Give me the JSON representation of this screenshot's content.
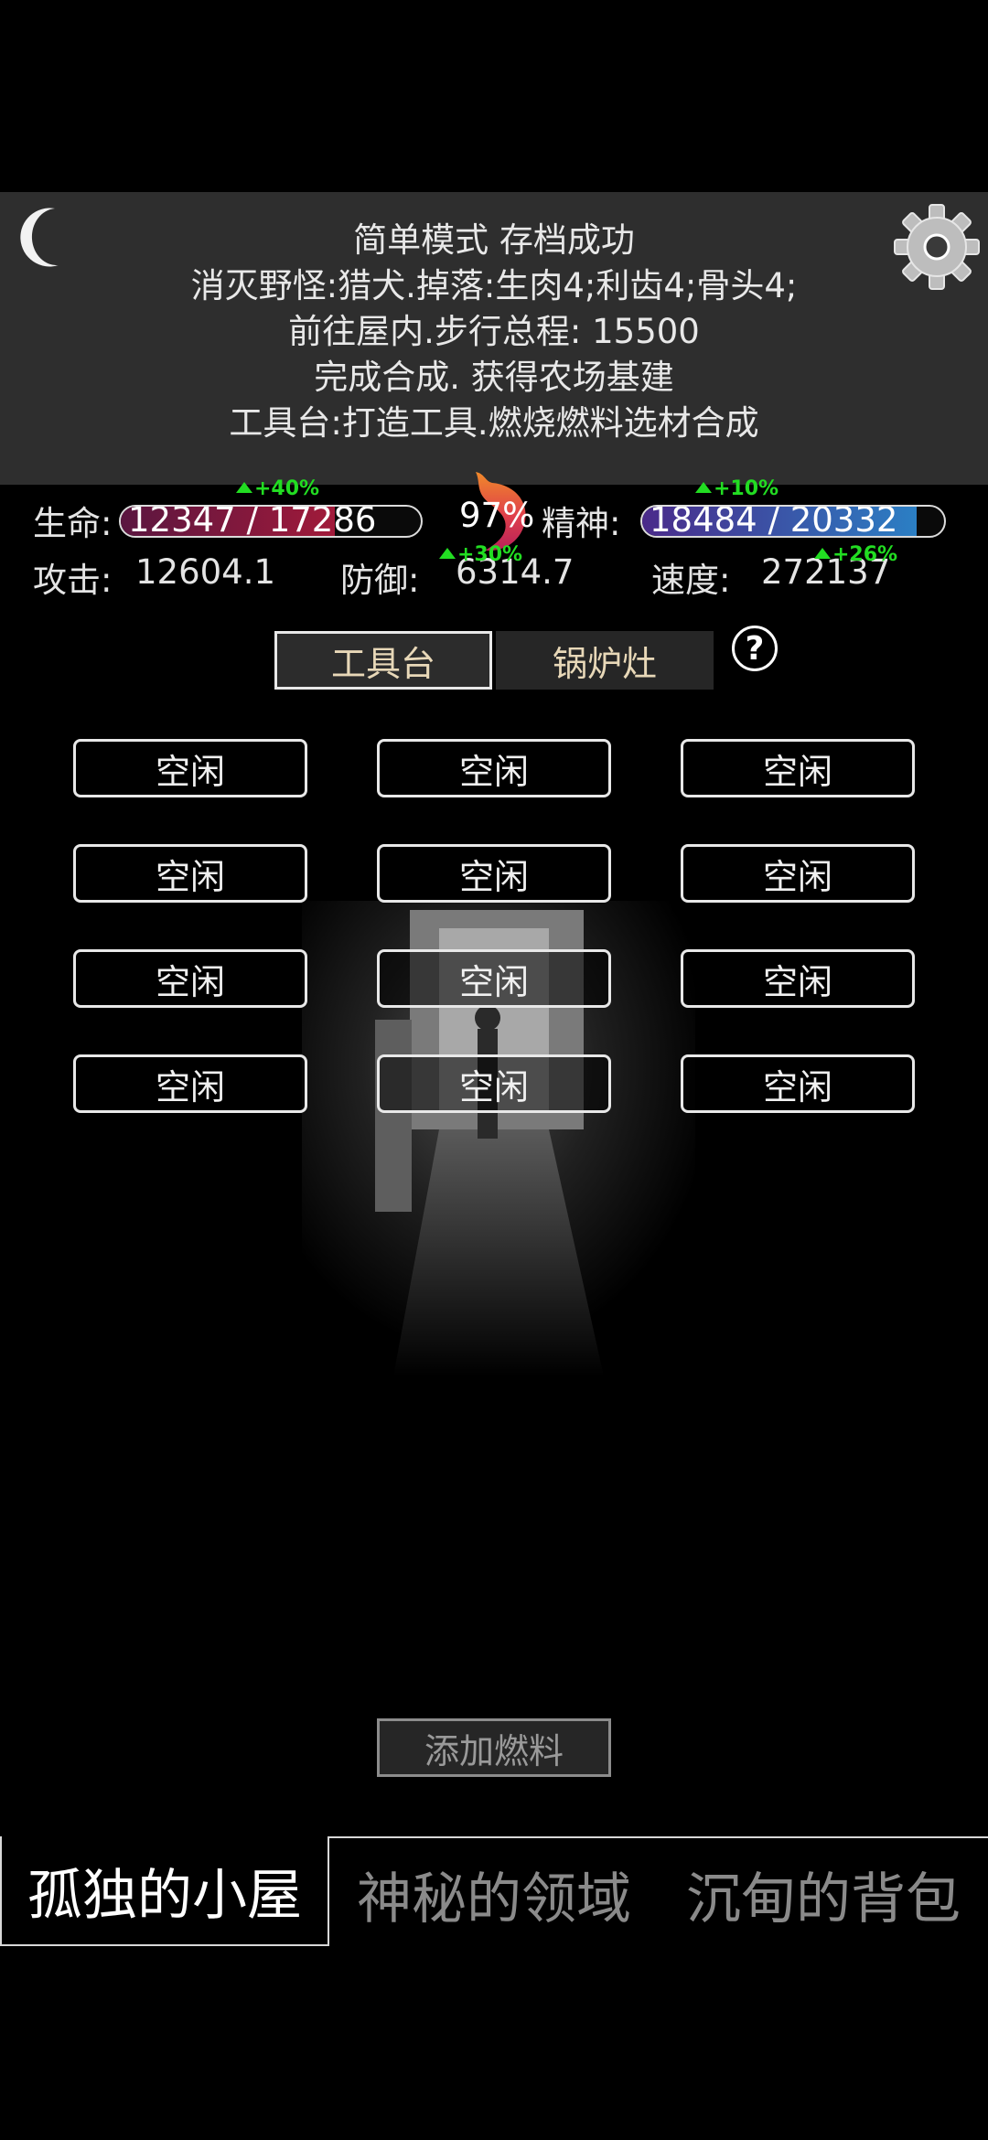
{
  "log": {
    "lines": [
      "简单模式 存档成功",
      "消灭野怪:猎犬.掉落:生肉4;利齿4;骨头4;",
      "前往屋内.步行总程: 15500",
      "完成合成. 获得农场基建",
      "工具台:打造工具.燃烧燃料选材合成"
    ]
  },
  "icons": {
    "moon": "moon-icon",
    "settings": "gear-icon",
    "hunger": "stomach-icon",
    "help": "question-icon"
  },
  "stats": {
    "hp": {
      "label": "生命:",
      "value": "12347 / 17286",
      "current": 12347,
      "max": 17286,
      "boost": "+40%",
      "color": "#a11a3a"
    },
    "satiety": {
      "value": "97%"
    },
    "spirit": {
      "label": "精神:",
      "value": "18484 / 20332",
      "current": 18484,
      "max": 20332,
      "boost": "+10%",
      "color": "#2b7fc4"
    },
    "attack": {
      "label": "攻击:",
      "value": "12604.1"
    },
    "defense": {
      "label": "防御:",
      "value": "6314.7",
      "boost": "+30%"
    },
    "speed": {
      "label": "速度:",
      "value": "272137",
      "boost": "+26%"
    }
  },
  "tabs": {
    "workbench": "工具台",
    "stove": "锅炉灶",
    "help": "?"
  },
  "slots": [
    "空闲",
    "空闲",
    "空闲",
    "空闲",
    "空闲",
    "空闲",
    "空闲",
    "空闲",
    "空闲",
    "空闲",
    "空闲",
    "空闲"
  ],
  "fuel_button": "添加燃料",
  "nav": {
    "cabin": "孤独的小屋",
    "domain": "神秘的领域",
    "bag": "沉甸的背包"
  }
}
